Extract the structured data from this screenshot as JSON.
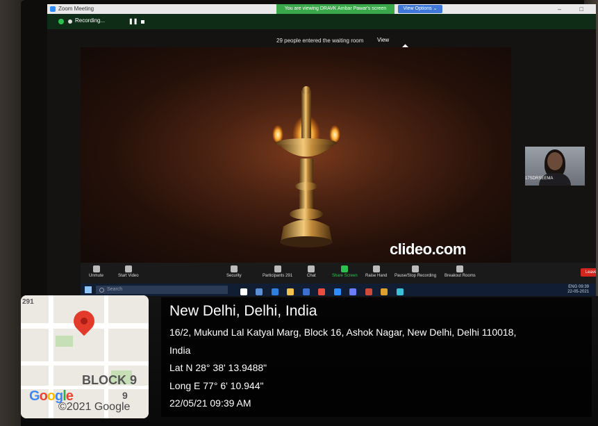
{
  "zoom": {
    "window_title": "Zoom Meeting",
    "recording_label": "Recording...",
    "share_banner": "You are viewing DRAVK Ambar Pawar's screen",
    "view_options": "View Options ⌄",
    "waiting_room_message": "29 people entered the waiting room",
    "view_button": "View",
    "video_watermark": "clideo.com",
    "participant_name": "17SDRSEEMA",
    "toolbar": {
      "unmute": "Unmute",
      "start_video": "Start Video",
      "security": "Security",
      "participants": "Participants",
      "participants_count": "291",
      "chat": "Chat",
      "share_screen": "Share Screen",
      "raise_hand": "Raise Hand",
      "pause_stop_recording": "Pause/Stop Recording",
      "breakout_rooms": "Breakout Rooms",
      "leave": "Leave"
    }
  },
  "taskbar": {
    "search_placeholder": "Search",
    "language": "ENG",
    "time": "09:39",
    "date": "22-05-2021"
  },
  "geotag": {
    "city": "New Delhi, Delhi, India",
    "address_line1": "16/2, Mukund Lal Katyal Marg, Block 16, Ashok Nagar, New Delhi, Delhi 110018,",
    "address_line2": "India",
    "latitude": "Lat N 28° 38' 13.9488\"",
    "longitude": "Long E 77° 6' 10.944\"",
    "datetime": "22/05/21 09:39 AM",
    "map_block_label": "BLOCK 9",
    "map_block_number": "9",
    "map_corner_number": "291",
    "google_logo": "Google",
    "map_copyright": "©2021 Google",
    "pin_color": "#e23b2c"
  }
}
